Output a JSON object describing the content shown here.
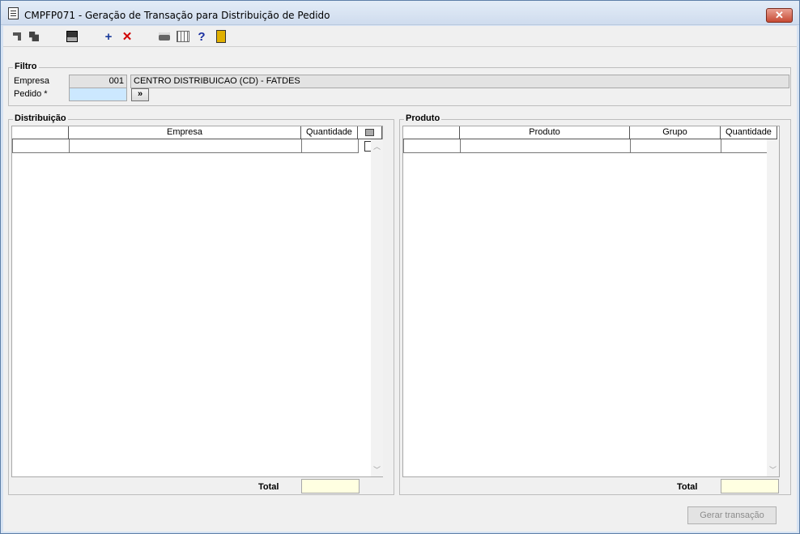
{
  "window": {
    "title": "CMPFP071 - Geração de Transação para Distribuição de Pedido",
    "close_label": "✕"
  },
  "toolbar": {
    "icons": [
      "nav-first-icon",
      "nav-copy-icon",
      "save-icon",
      "add-icon",
      "delete-icon",
      "print-icon",
      "grid-icon",
      "help-icon",
      "exit-icon"
    ],
    "add_symbol": "+",
    "delete_symbol": "✕",
    "help_symbol": "?"
  },
  "filtro": {
    "legend": "Filtro",
    "empresa_label": "Empresa",
    "empresa_code": "001",
    "empresa_name": "CENTRO DISTRIBUICAO (CD) - FATDES",
    "pedido_label": "Pedido *",
    "pedido_value": "",
    "lookup_label": "»"
  },
  "distribuicao": {
    "legend": "Distribuição",
    "columns": [
      "Empresa",
      "Quantidade"
    ],
    "total_label": "Total",
    "total_value": ""
  },
  "produto": {
    "legend": "Produto",
    "columns": [
      "Produto",
      "Grupo",
      "Quantidade"
    ],
    "total_label": "Total",
    "total_value": ""
  },
  "actions": {
    "generate_label": "Gerar transação"
  },
  "colors": {
    "pedido_field": "#cce8ff",
    "total_field": "#ffffe1"
  }
}
